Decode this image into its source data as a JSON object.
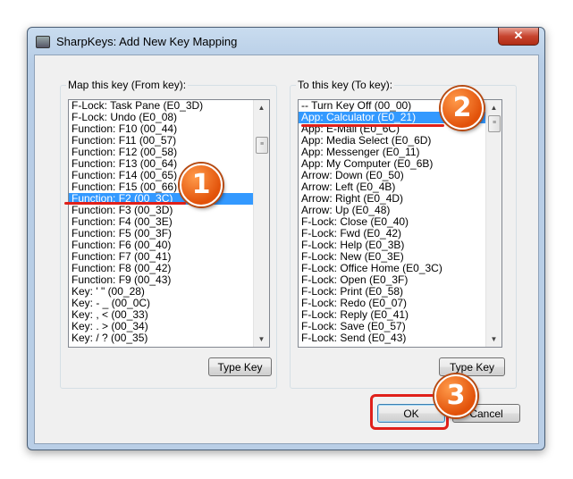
{
  "window": {
    "title": "SharpKeys: Add New Key Mapping",
    "close_label": "✕"
  },
  "from_group": {
    "label": "Map this key (From key):",
    "selected_index": 8,
    "items": [
      "F-Lock: Task Pane (E0_3D)",
      "F-Lock: Undo (E0_08)",
      "Function: F10 (00_44)",
      "Function: F11 (00_57)",
      "Function: F12 (00_58)",
      "Function: F13 (00_64)",
      "Function: F14 (00_65)",
      "Function: F15 (00_66)",
      "Function: F2 (00_3C)",
      "Function: F3 (00_3D)",
      "Function: F4 (00_3E)",
      "Function: F5 (00_3F)",
      "Function: F6 (00_40)",
      "Function: F7 (00_41)",
      "Function: F8 (00_42)",
      "Function: F9 (00_43)",
      "Key: ' \" (00_28)",
      "Key: - _ (00_0C)",
      "Key: , < (00_33)",
      "Key: . > (00_34)",
      "Key: / ? (00_35)"
    ],
    "type_key_label": "Type Key"
  },
  "to_group": {
    "label": "To this key (To key):",
    "selected_index": 1,
    "items": [
      "-- Turn Key Off (00_00)",
      "App: Calculator (E0_21)",
      "App: E-Mail (E0_6C)",
      "App: Media Select (E0_6D)",
      "App: Messenger (E0_11)",
      "App: My Computer (E0_6B)",
      "Arrow: Down (E0_50)",
      "Arrow: Left (E0_4B)",
      "Arrow: Right (E0_4D)",
      "Arrow: Up (E0_48)",
      "F-Lock: Close (E0_40)",
      "F-Lock: Fwd (E0_42)",
      "F-Lock: Help (E0_3B)",
      "F-Lock: New (E0_3E)",
      "F-Lock: Office Home (E0_3C)",
      "F-Lock: Open (E0_3F)",
      "F-Lock: Print (E0_58)",
      "F-Lock: Redo (E0_07)",
      "F-Lock: Reply (E0_41)",
      "F-Lock: Save (E0_57)",
      "F-Lock: Send (E0_43)"
    ],
    "type_key_label": "Type Key"
  },
  "buttons": {
    "ok_label": "OK",
    "cancel_label": "Cancel"
  },
  "annotations": {
    "step1": "1",
    "step2": "2",
    "step3": "3",
    "accent_color": "#e0201a",
    "badge_color": "#e2520a"
  },
  "scrollbar_glyphs": {
    "up": "▲",
    "down": "▼",
    "thumb": "≡"
  }
}
